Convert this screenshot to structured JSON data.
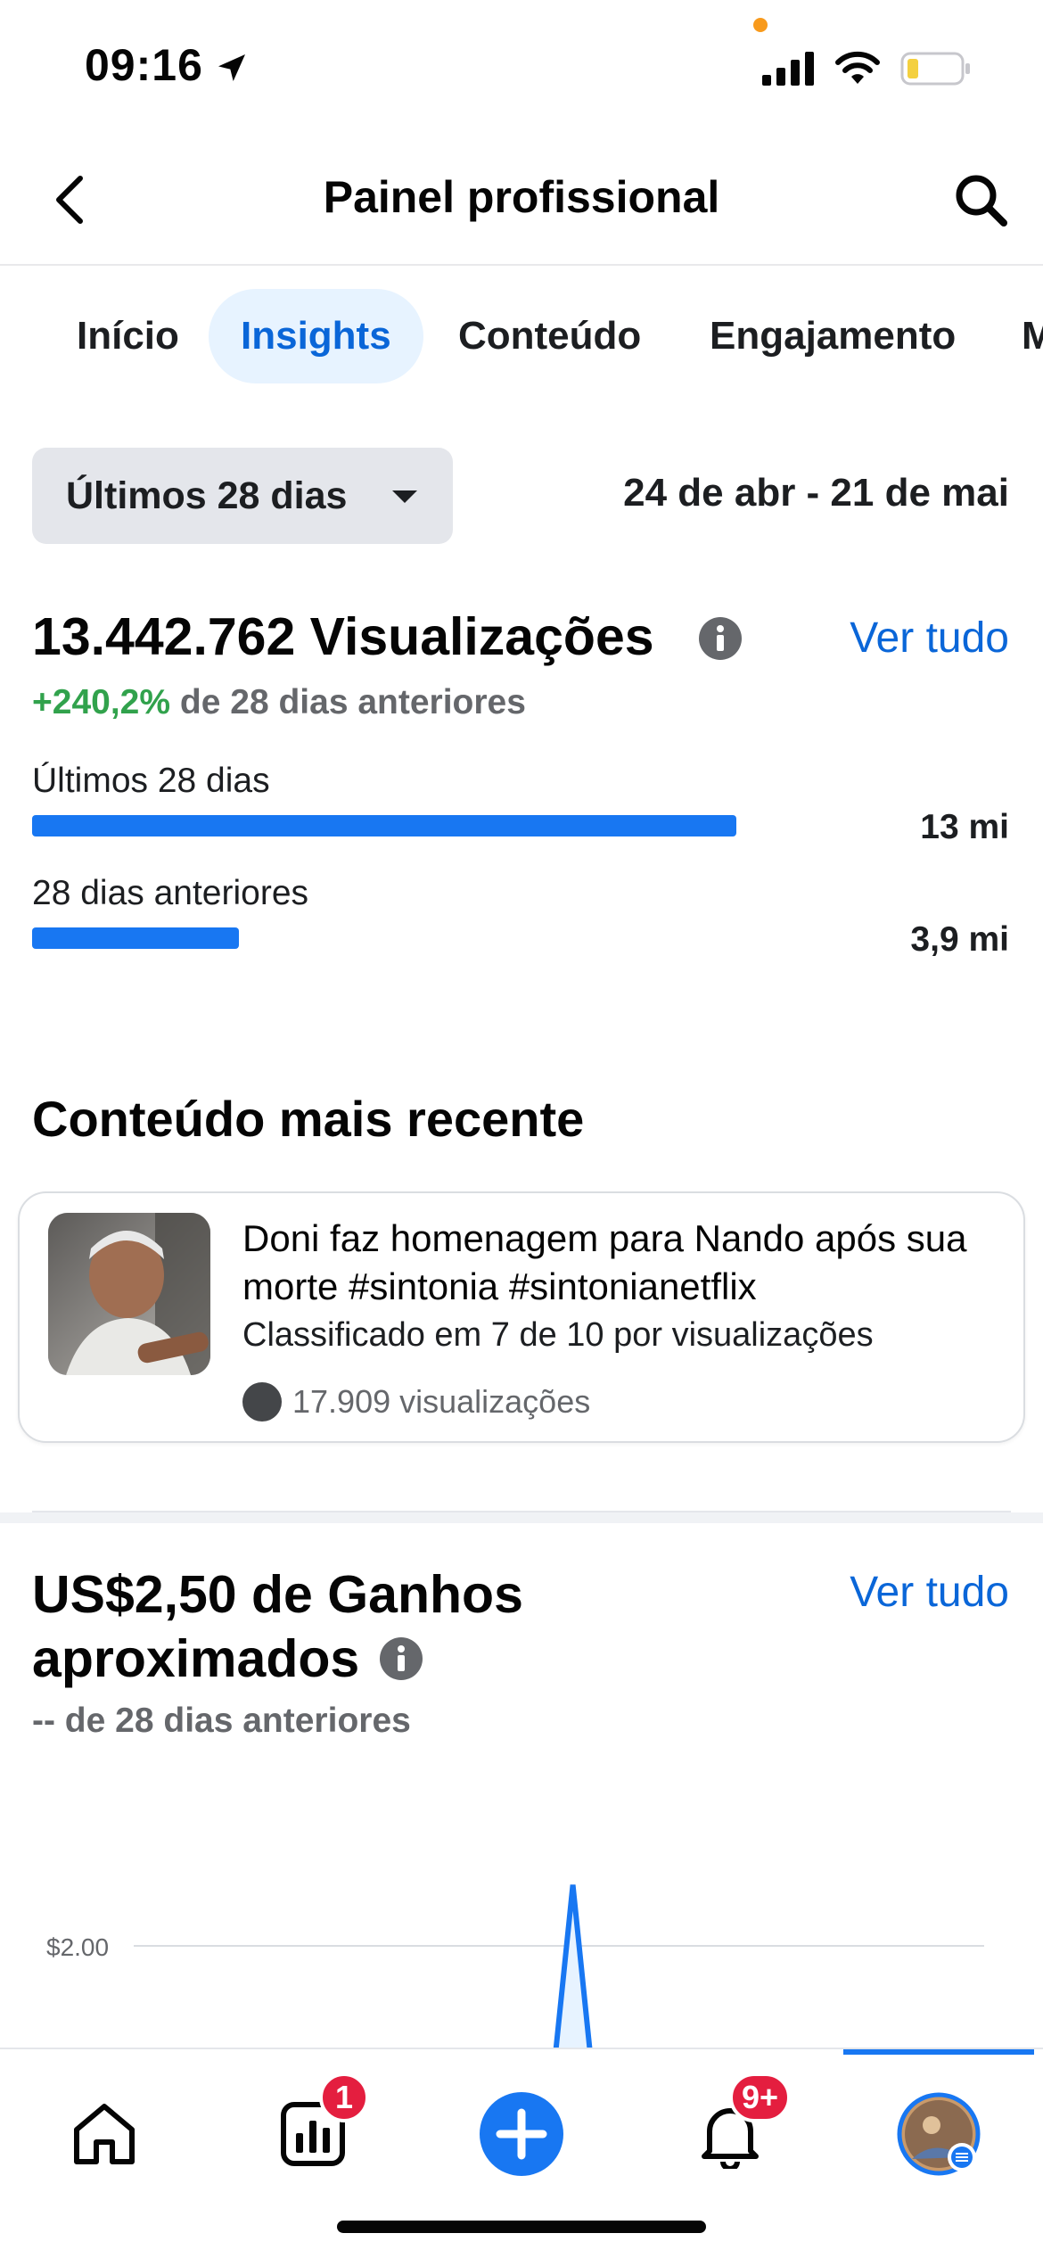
{
  "status_bar": {
    "time": "09:16"
  },
  "header": {
    "title": "Painel profissional"
  },
  "tabs": [
    {
      "label": "Início"
    },
    {
      "label": "Insights"
    },
    {
      "label": "Conteúdo"
    },
    {
      "label": "Engajamento"
    },
    {
      "label": "M"
    }
  ],
  "active_tab": "Insights",
  "period": {
    "selected": "Últimos 28 dias",
    "range": "24 de abr - 21 de mai"
  },
  "views": {
    "title": "13.442.762 Visualizações",
    "see_all": "Ver tudo",
    "change_value": "+240,2%",
    "change_text": "de 28 dias anteriores",
    "bars": [
      {
        "label": "Últimos 28 dias",
        "value": "13 mi",
        "fraction": 1.0
      },
      {
        "label": "28 dias anteriores",
        "value": "3,9 mi",
        "fraction": 0.294
      }
    ]
  },
  "recent": {
    "title": "Conteúdo mais recente",
    "card": {
      "title": "Doni faz homenagem para Nando após sua morte #sintonia #sintonianetflix",
      "rank": "Classificado em 7 de 10 por visualizações",
      "views": "17.909 visualizações"
    }
  },
  "earnings": {
    "title": "US$2,50 de Ganhos aproximados",
    "see_all": "Ver tudo",
    "change": "-- de 28 dias anteriores"
  },
  "chart_data": {
    "type": "area",
    "y_tick_labels": [
      "$2.00"
    ],
    "series": [
      {
        "values": [
          0,
          0,
          0,
          0,
          0,
          0,
          0,
          0,
          0,
          0,
          0,
          0,
          0,
          0,
          2.5,
          0,
          0,
          0,
          0,
          0,
          0,
          0,
          0,
          0,
          0,
          0,
          0,
          0
        ]
      }
    ],
    "grid": true
  },
  "bottom_nav": {
    "items": [
      {
        "name": "home"
      },
      {
        "name": "insights",
        "badge": "1"
      },
      {
        "name": "create"
      },
      {
        "name": "notifications",
        "badge": "9+"
      },
      {
        "name": "profile"
      }
    ]
  },
  "colors": {
    "accent": "#1877f2",
    "link": "#0a66d8",
    "positive": "#31a24c",
    "badge": "#e41e3f"
  }
}
